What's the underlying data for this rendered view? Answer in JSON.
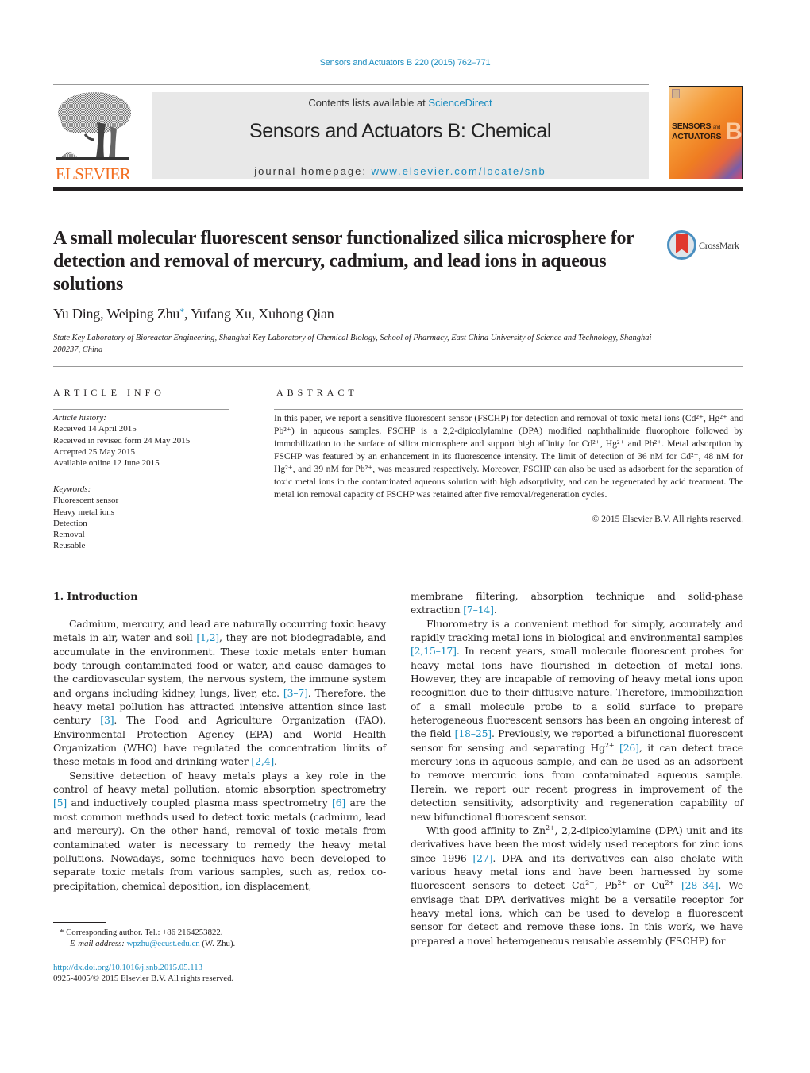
{
  "header": {
    "citation": "Sensors and Actuators B 220 (2015) 762–771",
    "contents_prefix": "Contents lists available at ",
    "contents_link": "ScienceDirect",
    "journal_title": "Sensors and Actuators B: Chemical",
    "homepage_prefix": "journal homepage: ",
    "homepage_link": "www.elsevier.com/locate/snb",
    "publisher_logo": "ELSEVIER",
    "cover_line1": "SENSORS",
    "cover_and": "and",
    "cover_line2": "ACTUATORS",
    "cover_letter": "B"
  },
  "article": {
    "title": "A small molecular fluorescent sensor functionalized silica microsphere for detection and removal of mercury, cadmium, and lead ions in aqueous solutions",
    "crossmark_label": "CrossMark",
    "authors": [
      {
        "name": "Yu Ding",
        "corresponding": false
      },
      {
        "name": "Weiping Zhu",
        "corresponding": true
      },
      {
        "name": "Yufang Xu",
        "corresponding": false
      },
      {
        "name": "Xuhong Qian",
        "corresponding": false
      }
    ],
    "author_separator": ", ",
    "corresponding_marker": "*",
    "affiliation": "State Key Laboratory of Bioreactor Engineering, Shanghai Key Laboratory of Chemical Biology, School of Pharmacy, East China University of Science and Technology, Shanghai 200237, China"
  },
  "article_info": {
    "heading": "ARTICLE INFO",
    "history_label": "Article history:",
    "history": [
      "Received 14 April 2015",
      "Received in revised form 24 May 2015",
      "Accepted 25 May 2015",
      "Available online 12 June 2015"
    ],
    "keywords_label": "Keywords:",
    "keywords": [
      "Fluorescent sensor",
      "Heavy metal ions",
      "Detection",
      "Removal",
      "Reusable"
    ]
  },
  "abstract": {
    "heading": "ABSTRACT",
    "text": "In this paper, we report a sensitive fluorescent sensor (FSCHP) for detection and removal of toxic metal ions (Cd²⁺, Hg²⁺ and Pb²⁺) in aqueous samples. FSCHP is a 2,2-dipicolylamine (DPA) modified naphthalimide fluorophore followed by immobilization to the surface of silica microsphere and support high affinity for Cd²⁺, Hg²⁺ and Pb²⁺. Metal adsorption by FSCHP was featured by an enhancement in its fluorescence intensity. The limit of detection of 36 nM for Cd²⁺, 48 nM for Hg²⁺, and 39 nM for Pb²⁺, was measured respectively. Moreover, FSCHP can also be used as adsorbent for the separation of toxic metal ions in the contaminated aqueous solution with high adsorptivity, and can be regenerated by acid treatment. The metal ion removal capacity of FSCHP was retained after five removal/regeneration cycles.",
    "copyright": "© 2015 Elsevier B.V. All rights reserved."
  },
  "introduction": {
    "heading": "1.  Introduction",
    "left_paragraphs": [
      [
        {
          "t": "Cadmium, mercury, and lead are naturally occurring toxic heavy metals in air, water and soil "
        },
        {
          "ref": "[1,2]"
        },
        {
          "t": ", they are not biodegradable, and accumulate in the environment. These toxic metals enter human body through contaminated food or water, and cause damages to the cardiovascular system, the nervous system, the immune system and organs including kidney, lungs, liver, etc. "
        },
        {
          "ref": "[3–7]"
        },
        {
          "t": ". Therefore, the heavy metal pollution has attracted intensive attention since last century "
        },
        {
          "ref": "[3]"
        },
        {
          "t": ". The Food and Agriculture Organization (FAO), Environmental Protection Agency (EPA) and World Health Organization (WHO) have regulated the concentration limits of these metals in food and drinking water "
        },
        {
          "ref": "[2,4]"
        },
        {
          "t": "."
        }
      ],
      [
        {
          "t": "Sensitive detection of heavy metals plays a key role in the control of heavy metal pollution, atomic absorption spectrometry "
        },
        {
          "ref": "[5]"
        },
        {
          "t": " and inductively coupled plasma mass spectrometry "
        },
        {
          "ref": "[6]"
        },
        {
          "t": " are the most common methods used to detect toxic metals (cadmium, lead and mercury). On the other hand, removal of toxic metals from contaminated water is necessary to remedy the heavy metal pollutions. Nowadays, some techniques have been developed to separate toxic metals from various samples, such as, redox co-precipitation, chemical deposition, ion displacement,"
        }
      ]
    ],
    "right_paragraphs": [
      [
        {
          "t": "membrane filtering, absorption technique and solid-phase extraction "
        },
        {
          "ref": "[7–14]"
        },
        {
          "t": "."
        }
      ],
      [
        {
          "t": "Fluorometry is a convenient method for simply, accurately and rapidly tracking metal ions in biological and environmental samples "
        },
        {
          "ref": "[2,15–17]"
        },
        {
          "t": ". In recent years, small molecule fluorescent probes for heavy metal ions have flourished in detection of metal ions. However, they are incapable of removing of heavy metal ions upon recognition due to their diffusive nature. Therefore, immobilization of a small molecule probe to a solid surface to prepare heterogeneous fluorescent sensors has been an ongoing interest of the field "
        },
        {
          "ref": "[18–25]"
        },
        {
          "t": ". Previously, we reported a bifunctional fluorescent sensor for sensing and separating Hg"
        },
        {
          "sup": "2+"
        },
        {
          "t": " "
        },
        {
          "ref": "[26]"
        },
        {
          "t": ", it can detect trace mercury ions in aqueous sample, and can be used as an adsorbent to remove mercuric ions from contaminated aqueous sample. Herein, we report our recent progress in improvement of the detection sensitivity, adsorptivity and regeneration capability of new bifunctional fluorescent sensor."
        }
      ],
      [
        {
          "t": "With good affinity to Zn"
        },
        {
          "sup": "2+"
        },
        {
          "t": ", 2,2-dipicolylamine (DPA) unit and its derivatives have been the most widely used receptors for zinc ions since 1996 "
        },
        {
          "ref": "[27]"
        },
        {
          "t": ". DPA and its derivatives can also chelate with various heavy metal ions and have been harnessed by some fluorescent sensors to detect Cd"
        },
        {
          "sup": "2+"
        },
        {
          "t": ", Pb"
        },
        {
          "sup": "2+"
        },
        {
          "t": " or Cu"
        },
        {
          "sup": "2+"
        },
        {
          "t": " "
        },
        {
          "ref": "[28–34]"
        },
        {
          "t": ". We envisage that DPA derivatives might be a versatile receptor for heavy metal ions, which can be used to develop a fluorescent sensor for detect and remove these ions. In this work, we have prepared a novel heterogeneous reusable assembly (FSCHP) for"
        }
      ]
    ]
  },
  "footnotes": {
    "corresponding": "*  Corresponding author. Tel.: +86 2164253822.",
    "email_label": "E-mail address: ",
    "email": "wpzhu@ecust.edu.cn",
    "email_suffix": " (W. Zhu).",
    "doi": "http://dx.doi.org/10.1016/j.snb.2015.05.113",
    "issn_copyright": "0925-4005/© 2015 Elsevier B.V. All rights reserved."
  }
}
